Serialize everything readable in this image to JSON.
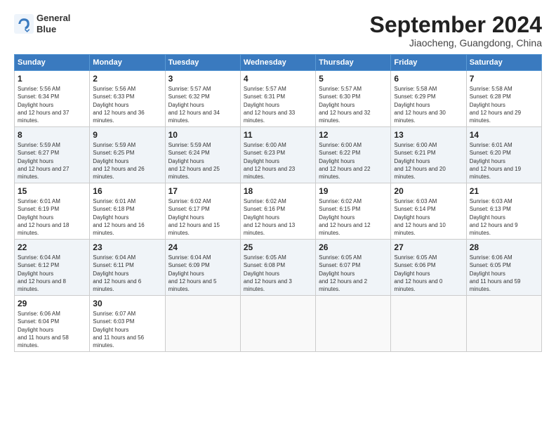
{
  "header": {
    "logo_line1": "General",
    "logo_line2": "Blue",
    "month": "September 2024",
    "location": "Jiaocheng, Guangdong, China"
  },
  "days_of_week": [
    "Sunday",
    "Monday",
    "Tuesday",
    "Wednesday",
    "Thursday",
    "Friday",
    "Saturday"
  ],
  "weeks": [
    [
      {
        "day": 1,
        "rise": "5:56 AM",
        "set": "6:34 PM",
        "daylight": "12 hours and 37 minutes."
      },
      {
        "day": 2,
        "rise": "5:56 AM",
        "set": "6:33 PM",
        "daylight": "12 hours and 36 minutes."
      },
      {
        "day": 3,
        "rise": "5:57 AM",
        "set": "6:32 PM",
        "daylight": "12 hours and 34 minutes."
      },
      {
        "day": 4,
        "rise": "5:57 AM",
        "set": "6:31 PM",
        "daylight": "12 hours and 33 minutes."
      },
      {
        "day": 5,
        "rise": "5:57 AM",
        "set": "6:30 PM",
        "daylight": "12 hours and 32 minutes."
      },
      {
        "day": 6,
        "rise": "5:58 AM",
        "set": "6:29 PM",
        "daylight": "12 hours and 30 minutes."
      },
      {
        "day": 7,
        "rise": "5:58 AM",
        "set": "6:28 PM",
        "daylight": "12 hours and 29 minutes."
      }
    ],
    [
      {
        "day": 8,
        "rise": "5:59 AM",
        "set": "6:27 PM",
        "daylight": "12 hours and 27 minutes."
      },
      {
        "day": 9,
        "rise": "5:59 AM",
        "set": "6:25 PM",
        "daylight": "12 hours and 26 minutes."
      },
      {
        "day": 10,
        "rise": "5:59 AM",
        "set": "6:24 PM",
        "daylight": "12 hours and 25 minutes."
      },
      {
        "day": 11,
        "rise": "6:00 AM",
        "set": "6:23 PM",
        "daylight": "12 hours and 23 minutes."
      },
      {
        "day": 12,
        "rise": "6:00 AM",
        "set": "6:22 PM",
        "daylight": "12 hours and 22 minutes."
      },
      {
        "day": 13,
        "rise": "6:00 AM",
        "set": "6:21 PM",
        "daylight": "12 hours and 20 minutes."
      },
      {
        "day": 14,
        "rise": "6:01 AM",
        "set": "6:20 PM",
        "daylight": "12 hours and 19 minutes."
      }
    ],
    [
      {
        "day": 15,
        "rise": "6:01 AM",
        "set": "6:19 PM",
        "daylight": "12 hours and 18 minutes."
      },
      {
        "day": 16,
        "rise": "6:01 AM",
        "set": "6:18 PM",
        "daylight": "12 hours and 16 minutes."
      },
      {
        "day": 17,
        "rise": "6:02 AM",
        "set": "6:17 PM",
        "daylight": "12 hours and 15 minutes."
      },
      {
        "day": 18,
        "rise": "6:02 AM",
        "set": "6:16 PM",
        "daylight": "12 hours and 13 minutes."
      },
      {
        "day": 19,
        "rise": "6:02 AM",
        "set": "6:15 PM",
        "daylight": "12 hours and 12 minutes."
      },
      {
        "day": 20,
        "rise": "6:03 AM",
        "set": "6:14 PM",
        "daylight": "12 hours and 10 minutes."
      },
      {
        "day": 21,
        "rise": "6:03 AM",
        "set": "6:13 PM",
        "daylight": "12 hours and 9 minutes."
      }
    ],
    [
      {
        "day": 22,
        "rise": "6:04 AM",
        "set": "6:12 PM",
        "daylight": "12 hours and 8 minutes."
      },
      {
        "day": 23,
        "rise": "6:04 AM",
        "set": "6:11 PM",
        "daylight": "12 hours and 6 minutes."
      },
      {
        "day": 24,
        "rise": "6:04 AM",
        "set": "6:09 PM",
        "daylight": "12 hours and 5 minutes."
      },
      {
        "day": 25,
        "rise": "6:05 AM",
        "set": "6:08 PM",
        "daylight": "12 hours and 3 minutes."
      },
      {
        "day": 26,
        "rise": "6:05 AM",
        "set": "6:07 PM",
        "daylight": "12 hours and 2 minutes."
      },
      {
        "day": 27,
        "rise": "6:05 AM",
        "set": "6:06 PM",
        "daylight": "12 hours and 0 minutes."
      },
      {
        "day": 28,
        "rise": "6:06 AM",
        "set": "6:05 PM",
        "daylight": "11 hours and 59 minutes."
      }
    ],
    [
      {
        "day": 29,
        "rise": "6:06 AM",
        "set": "6:04 PM",
        "daylight": "11 hours and 58 minutes."
      },
      {
        "day": 30,
        "rise": "6:07 AM",
        "set": "6:03 PM",
        "daylight": "11 hours and 56 minutes."
      },
      null,
      null,
      null,
      null,
      null
    ]
  ]
}
